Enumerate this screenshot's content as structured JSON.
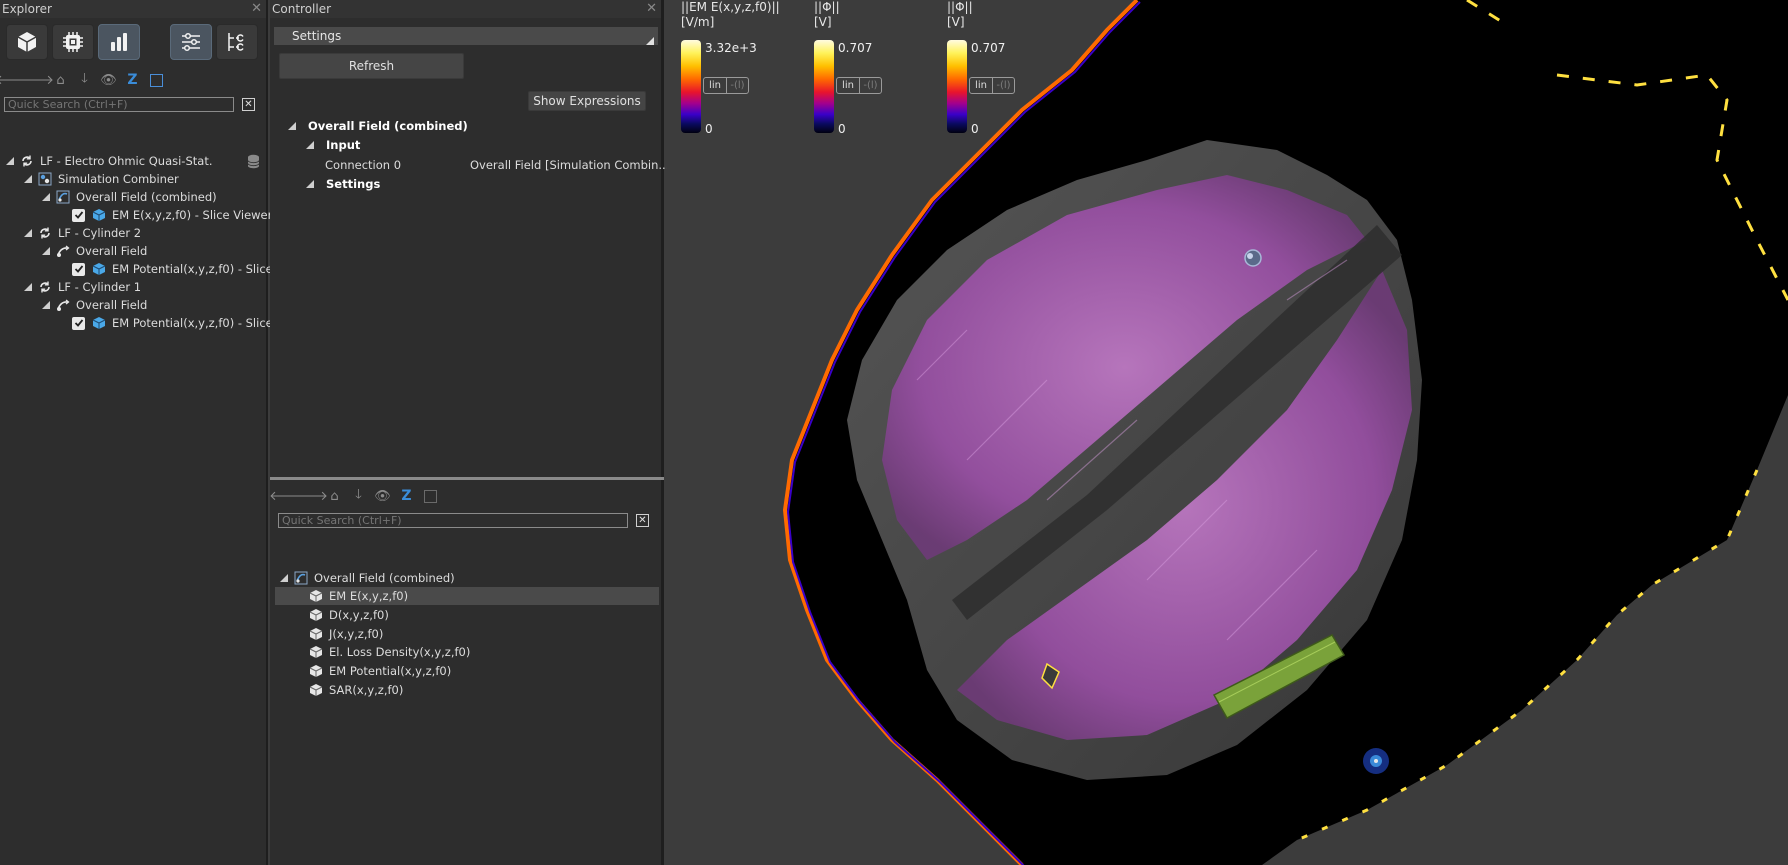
{
  "explorer": {
    "title": "Explorer",
    "search_placeholder": "Quick Search (Ctrl+F)",
    "tree": [
      {
        "label": "LF - Electro Ohmic Quasi-Stat."
      },
      {
        "label": "Simulation Combiner"
      },
      {
        "label": "Overall Field (combined)"
      },
      {
        "label": "EM E(x,y,z,f0) - Slice Viewer"
      },
      {
        "label": "LF - Cylinder 2"
      },
      {
        "label": "Overall Field"
      },
      {
        "label": "EM Potential(x,y,z,f0) - Slice"
      },
      {
        "label": "LF - Cylinder 1"
      },
      {
        "label": "Overall Field"
      },
      {
        "label": "EM Potential(x,y,z,f0) - Slice"
      }
    ]
  },
  "controller": {
    "title": "Controller",
    "settings_label": "Settings",
    "refresh_label": "Refresh",
    "show_expressions_label": "Show Expressions",
    "props": {
      "root": "Overall Field (combined)",
      "input": "Input",
      "connection_label": "Connection 0",
      "connection_value": "Overall Field [Simulation Combin...",
      "settings": "Settings"
    },
    "search_placeholder": "Quick Search (Ctrl+F)",
    "outputs_root": "Overall Field (combined)",
    "outputs": [
      "EM E(x,y,z,f0)",
      "D(x,y,z,f0)",
      "J(x,y,z,f0)",
      "El. Loss Density(x,y,z,f0)",
      "EM Potential(x,y,z,f0)",
      "SAR(x,y,z,f0)"
    ]
  },
  "view": {
    "legends": [
      {
        "title": "||EM E(x,y,z,f0)||\n[V/m]",
        "max": "3.32e+3",
        "min": "0",
        "lin": "lin",
        "log": "-(l)"
      },
      {
        "title": "||Φ||\n[V]",
        "max": "0.707",
        "min": "0",
        "lin": "lin",
        "log": "-(l)"
      },
      {
        "title": "||Φ||\n[V]",
        "max": "0.707",
        "min": "0",
        "lin": "lin",
        "log": "-(l)"
      }
    ]
  },
  "colors": {
    "panel_bg": "#2d2d2d",
    "view_bg": "#3c3c3c",
    "tissue": "#b266b8",
    "electrode": "#7aa23a"
  }
}
